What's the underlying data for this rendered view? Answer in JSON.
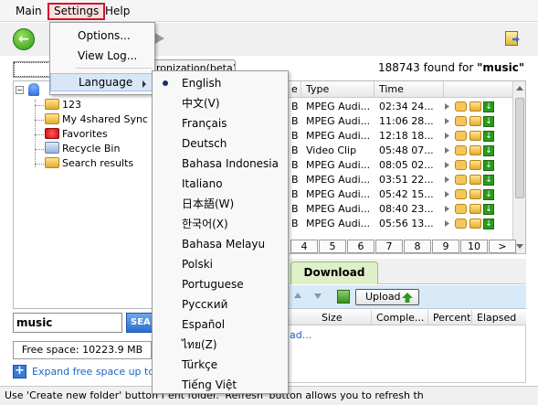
{
  "menubar": {
    "items": [
      "Main",
      "Settings",
      "Help"
    ]
  },
  "settings_menu": {
    "options": [
      "Options...",
      "View Log...",
      "Language"
    ]
  },
  "language_menu": {
    "selected": "English",
    "items": [
      "English",
      "中文(V)",
      "Français",
      "Deutsch",
      "Bahasa Indonesia",
      "Italiano",
      "日本語(W)",
      "한국어(X)",
      "Bahasa Melayu",
      "Polski",
      "Portuguese",
      "Русский",
      "Español",
      "ไทย(Z)",
      "Türkçe",
      "Tiếng Việt"
    ]
  },
  "search_bar": {
    "sync_tab_label": "ronization(beta)",
    "found_count": "188743 found for ",
    "found_query": "\"music\""
  },
  "tree": {
    "items": [
      "123",
      "My 4shared Sync",
      "Favorites",
      "Recycle Bin",
      "Search results"
    ]
  },
  "results": {
    "columns": [
      "e",
      "Type",
      "Time"
    ],
    "rows": [
      {
        "size": "B",
        "type": "MPEG Audi...",
        "time": "02:34 24..."
      },
      {
        "size": "B",
        "type": "MPEG Audi...",
        "time": "11:06 28..."
      },
      {
        "size": "B",
        "type": "MPEG Audi...",
        "time": "12:18 18..."
      },
      {
        "size": "B",
        "type": "Video Clip",
        "time": "05:48 07..."
      },
      {
        "size": "B",
        "type": "MPEG Audi...",
        "time": "08:05 02..."
      },
      {
        "size": "B",
        "type": "MPEG Audi...",
        "time": "03:51 22..."
      },
      {
        "size": "B",
        "type": "MPEG Audi...",
        "time": "05:42 15..."
      },
      {
        "size": "B",
        "type": "MPEG Audi...",
        "time": "08:40 23..."
      },
      {
        "size": "B",
        "type": "MPEG Audi...",
        "time": "05:56 13..."
      }
    ],
    "pages": [
      "4",
      "5",
      "6",
      "7",
      "8",
      "9",
      "10",
      ">"
    ]
  },
  "download": {
    "tab_label": "Download",
    "upload_label": "Upload",
    "columns": [
      "Size",
      "Comple...",
      "Percent",
      "Elapsed"
    ],
    "loading_text": "ad..."
  },
  "search": {
    "query": "music",
    "button_label": "SEA"
  },
  "storage": {
    "free_space": "Free space: 10223.9 MB",
    "expand_text": "Expand free space up to 1"
  },
  "status": {
    "text": "Use 'Create new folder' button f                                     ent folder. 'Refresh' button allows you to refresh th"
  }
}
